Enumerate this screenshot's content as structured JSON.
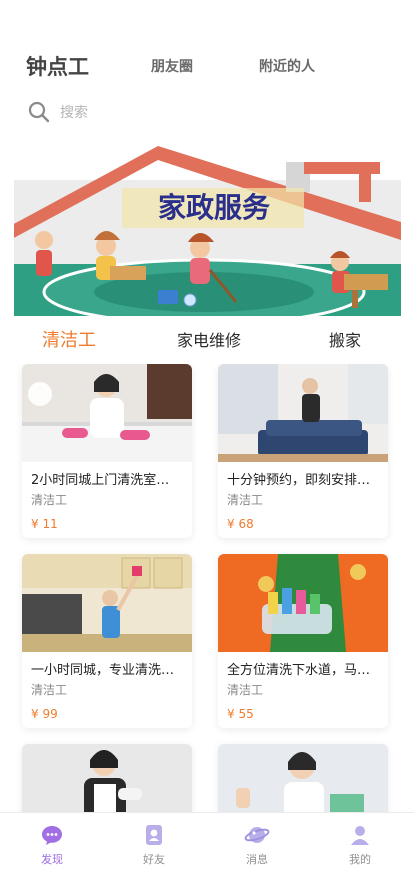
{
  "header": {
    "tabs": [
      "钟点工",
      "朋友圈",
      "附近的人"
    ]
  },
  "search": {
    "placeholder": "搜索"
  },
  "banner": {
    "title": "家政服务"
  },
  "categories": [
    "清洁工",
    "家电维修",
    "搬家"
  ],
  "listings": [
    {
      "title": "2小时同城上门清洗室…",
      "category": "清洁工",
      "price": "¥ 11"
    },
    {
      "title": "十分钟预约，即刻安排…",
      "category": "清洁工",
      "price": "¥ 68"
    },
    {
      "title": "一小时同城，专业清洗…",
      "category": "清洁工",
      "price": "¥ 99"
    },
    {
      "title": "全方位清洗下水道，马…",
      "category": "清洁工",
      "price": "¥ 55"
    },
    {
      "title": "",
      "category": "",
      "price": ""
    },
    {
      "title": "",
      "category": "",
      "price": ""
    }
  ],
  "tabbar": {
    "items": [
      {
        "label": "发现",
        "icon": "discover-icon",
        "active": true
      },
      {
        "label": "好友",
        "icon": "friends-icon",
        "active": false
      },
      {
        "label": "消息",
        "icon": "planet-icon",
        "active": false
      },
      {
        "label": "我的",
        "icon": "person-icon",
        "active": false
      }
    ]
  },
  "colors": {
    "accent": "#ef7b2e",
    "tab_active": "#9b6ce0",
    "tab_inactive": "#8f8f8f"
  }
}
